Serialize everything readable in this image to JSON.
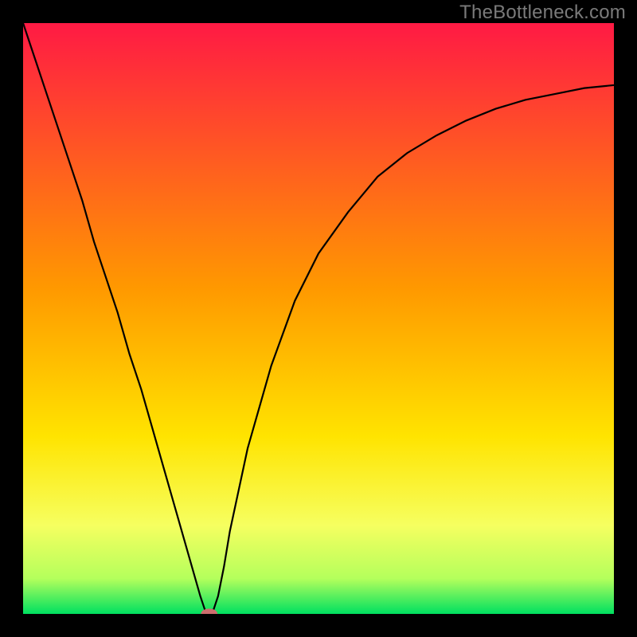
{
  "watermark": "TheBottleneck.com",
  "chart_data": {
    "type": "line",
    "title": "",
    "xlabel": "",
    "ylabel": "",
    "xlim": [
      0,
      100
    ],
    "ylim": [
      0,
      100
    ],
    "background_gradient": {
      "stops": [
        {
          "offset": 0,
          "color": "#ff1a44"
        },
        {
          "offset": 45,
          "color": "#ff9900"
        },
        {
          "offset": 70,
          "color": "#ffe400"
        },
        {
          "offset": 85,
          "color": "#f6ff60"
        },
        {
          "offset": 94,
          "color": "#b4ff5c"
        },
        {
          "offset": 100,
          "color": "#00e060"
        }
      ]
    },
    "series": [
      {
        "name": "bottleneck-curve",
        "color": "#000000",
        "width": 2.2,
        "x": [
          0,
          2,
          4,
          6,
          8,
          10,
          12,
          14,
          16,
          18,
          20,
          22,
          24,
          26,
          28,
          30,
          31,
          32,
          33,
          34,
          35,
          38,
          42,
          46,
          50,
          55,
          60,
          65,
          70,
          75,
          80,
          85,
          90,
          95,
          100
        ],
        "y": [
          100,
          94,
          88,
          82,
          76,
          70,
          63,
          57,
          51,
          44,
          38,
          31,
          24,
          17,
          10,
          3,
          0,
          0,
          3,
          8,
          14,
          28,
          42,
          53,
          61,
          68,
          74,
          78,
          81,
          83.5,
          85.5,
          87,
          88,
          89,
          89.5
        ]
      }
    ],
    "marker": {
      "name": "optimum-marker",
      "x": 31.5,
      "y": 0,
      "rx": 1.4,
      "ry": 0.9,
      "fill": "#cd6e6e"
    }
  }
}
